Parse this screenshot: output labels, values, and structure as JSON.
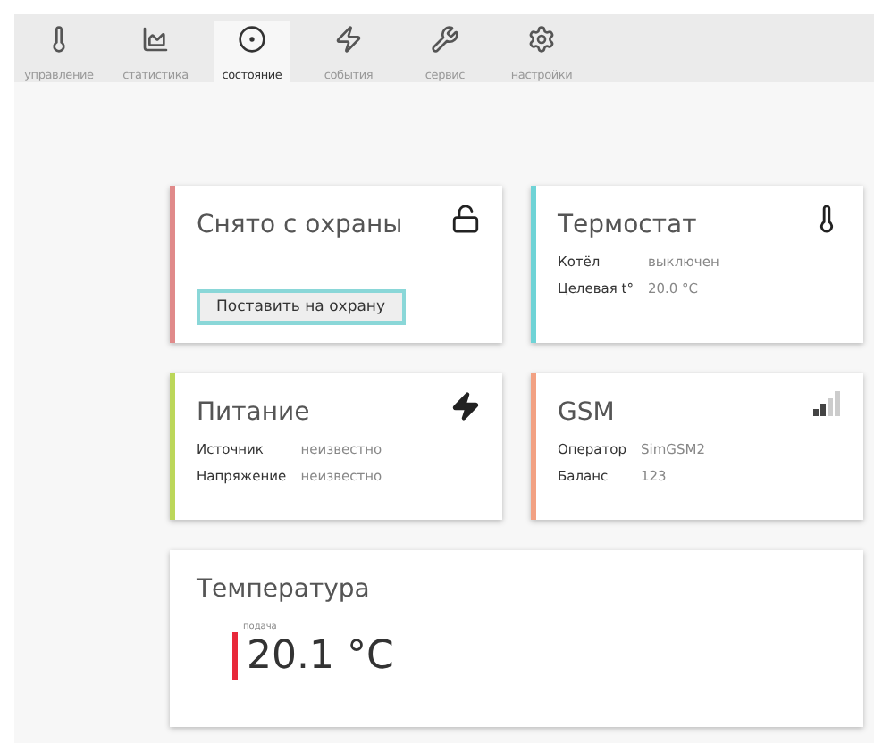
{
  "tabs": [
    {
      "label": "управление",
      "selected": false
    },
    {
      "label": "статистика",
      "selected": false
    },
    {
      "label": "состояние",
      "selected": true
    },
    {
      "label": "события",
      "selected": false
    },
    {
      "label": "сервис",
      "selected": false
    },
    {
      "label": "настройки",
      "selected": false
    }
  ],
  "cards": [
    {
      "kind": "security",
      "title": "Снято с охраны",
      "color": "#e08a8a",
      "button": "Поставить на охрану"
    },
    {
      "kind": "thermostat",
      "title": "Термостат",
      "color": "#6fd3d6",
      "rows": [
        {
          "label": "Котёл",
          "value": "выключен"
        },
        {
          "label": "Целевая t°",
          "value": "20.0 °C"
        }
      ]
    },
    {
      "kind": "power",
      "title": "Питание",
      "color": "#bcd75a",
      "rows": [
        {
          "label": "Источник",
          "value": "неизвестно"
        },
        {
          "label": "Напряжение",
          "value": "неизвестно"
        }
      ]
    },
    {
      "kind": "gsm",
      "title": "GSM",
      "color": "#f2a183",
      "rows": [
        {
          "label": "Оператор",
          "value": "SimGSM2"
        },
        {
          "label": "Баланс",
          "value": "123"
        }
      ]
    },
    {
      "kind": "temperature",
      "title": "Температура",
      "sensors": [
        {
          "label": "подача",
          "value": "20.1 °C",
          "color": "#e8283a"
        }
      ]
    }
  ]
}
